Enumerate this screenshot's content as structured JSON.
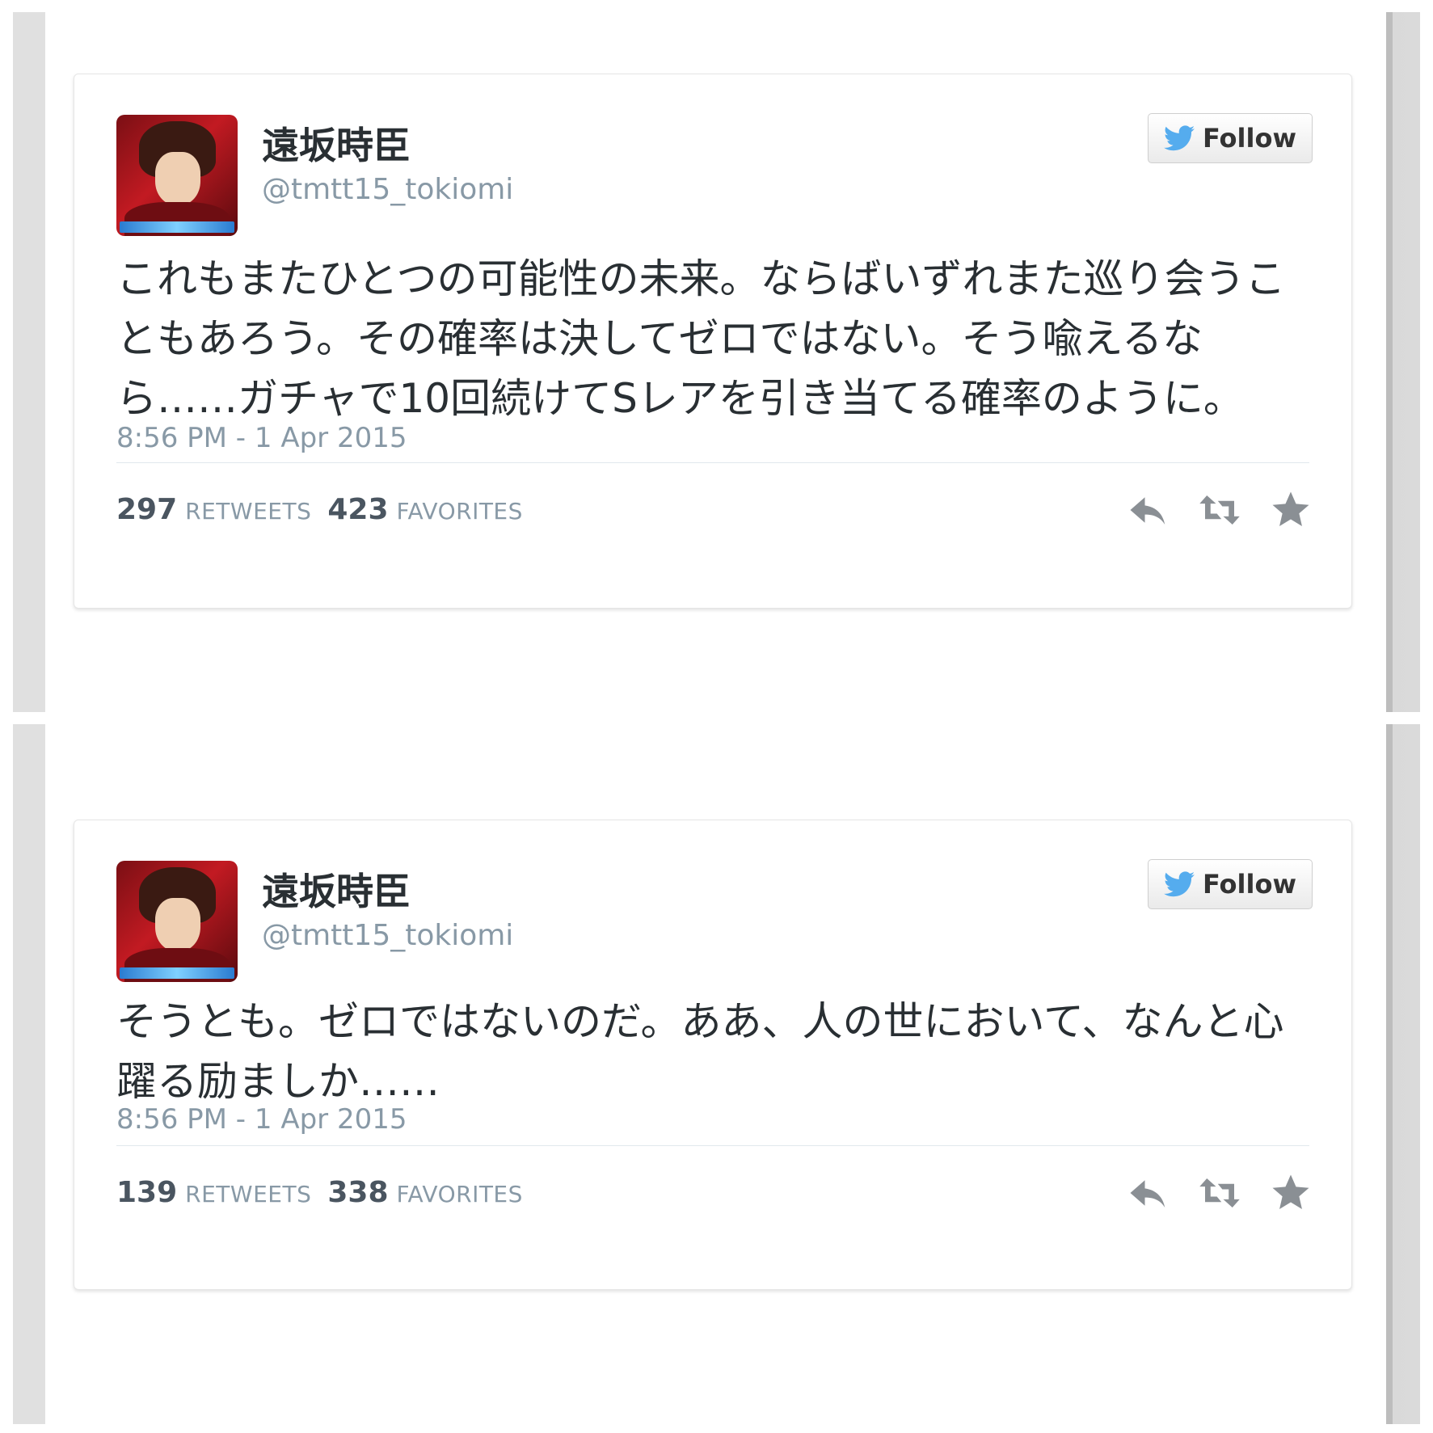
{
  "tweets": [
    {
      "name": "遠坂時臣",
      "handle": "@tmtt15_tokiomi",
      "follow_label": "Follow",
      "text": "これもまたひとつの可能性の未来。ならばいずれまた巡り会うこともあろう。その確率は決してゼロではない。そう喩えるなら……ガチャで10回続けてSレアを引き当てる確率のように。",
      "time": "8:56 PM - 1 Apr 2015",
      "retweets": "297",
      "retweets_label": "RETWEETS",
      "favorites": "423",
      "favorites_label": "FAVORITES"
    },
    {
      "name": "遠坂時臣",
      "handle": "@tmtt15_tokiomi",
      "follow_label": "Follow",
      "text": "そうとも。ゼロではないのだ。ああ、人の世において、なんと心躍る励ましか……",
      "time": "8:56 PM - 1 Apr 2015",
      "retweets": "139",
      "retweets_label": "RETWEETS",
      "favorites": "338",
      "favorites_label": "FAVORITES"
    }
  ],
  "colors": {
    "twitter_blue": "#55acee",
    "text": "#292f33",
    "muted": "#8899a6",
    "icon": "#8a8f94"
  },
  "icons": [
    "twitter-bird-icon",
    "reply-icon",
    "retweet-icon",
    "favorite-star-icon"
  ]
}
